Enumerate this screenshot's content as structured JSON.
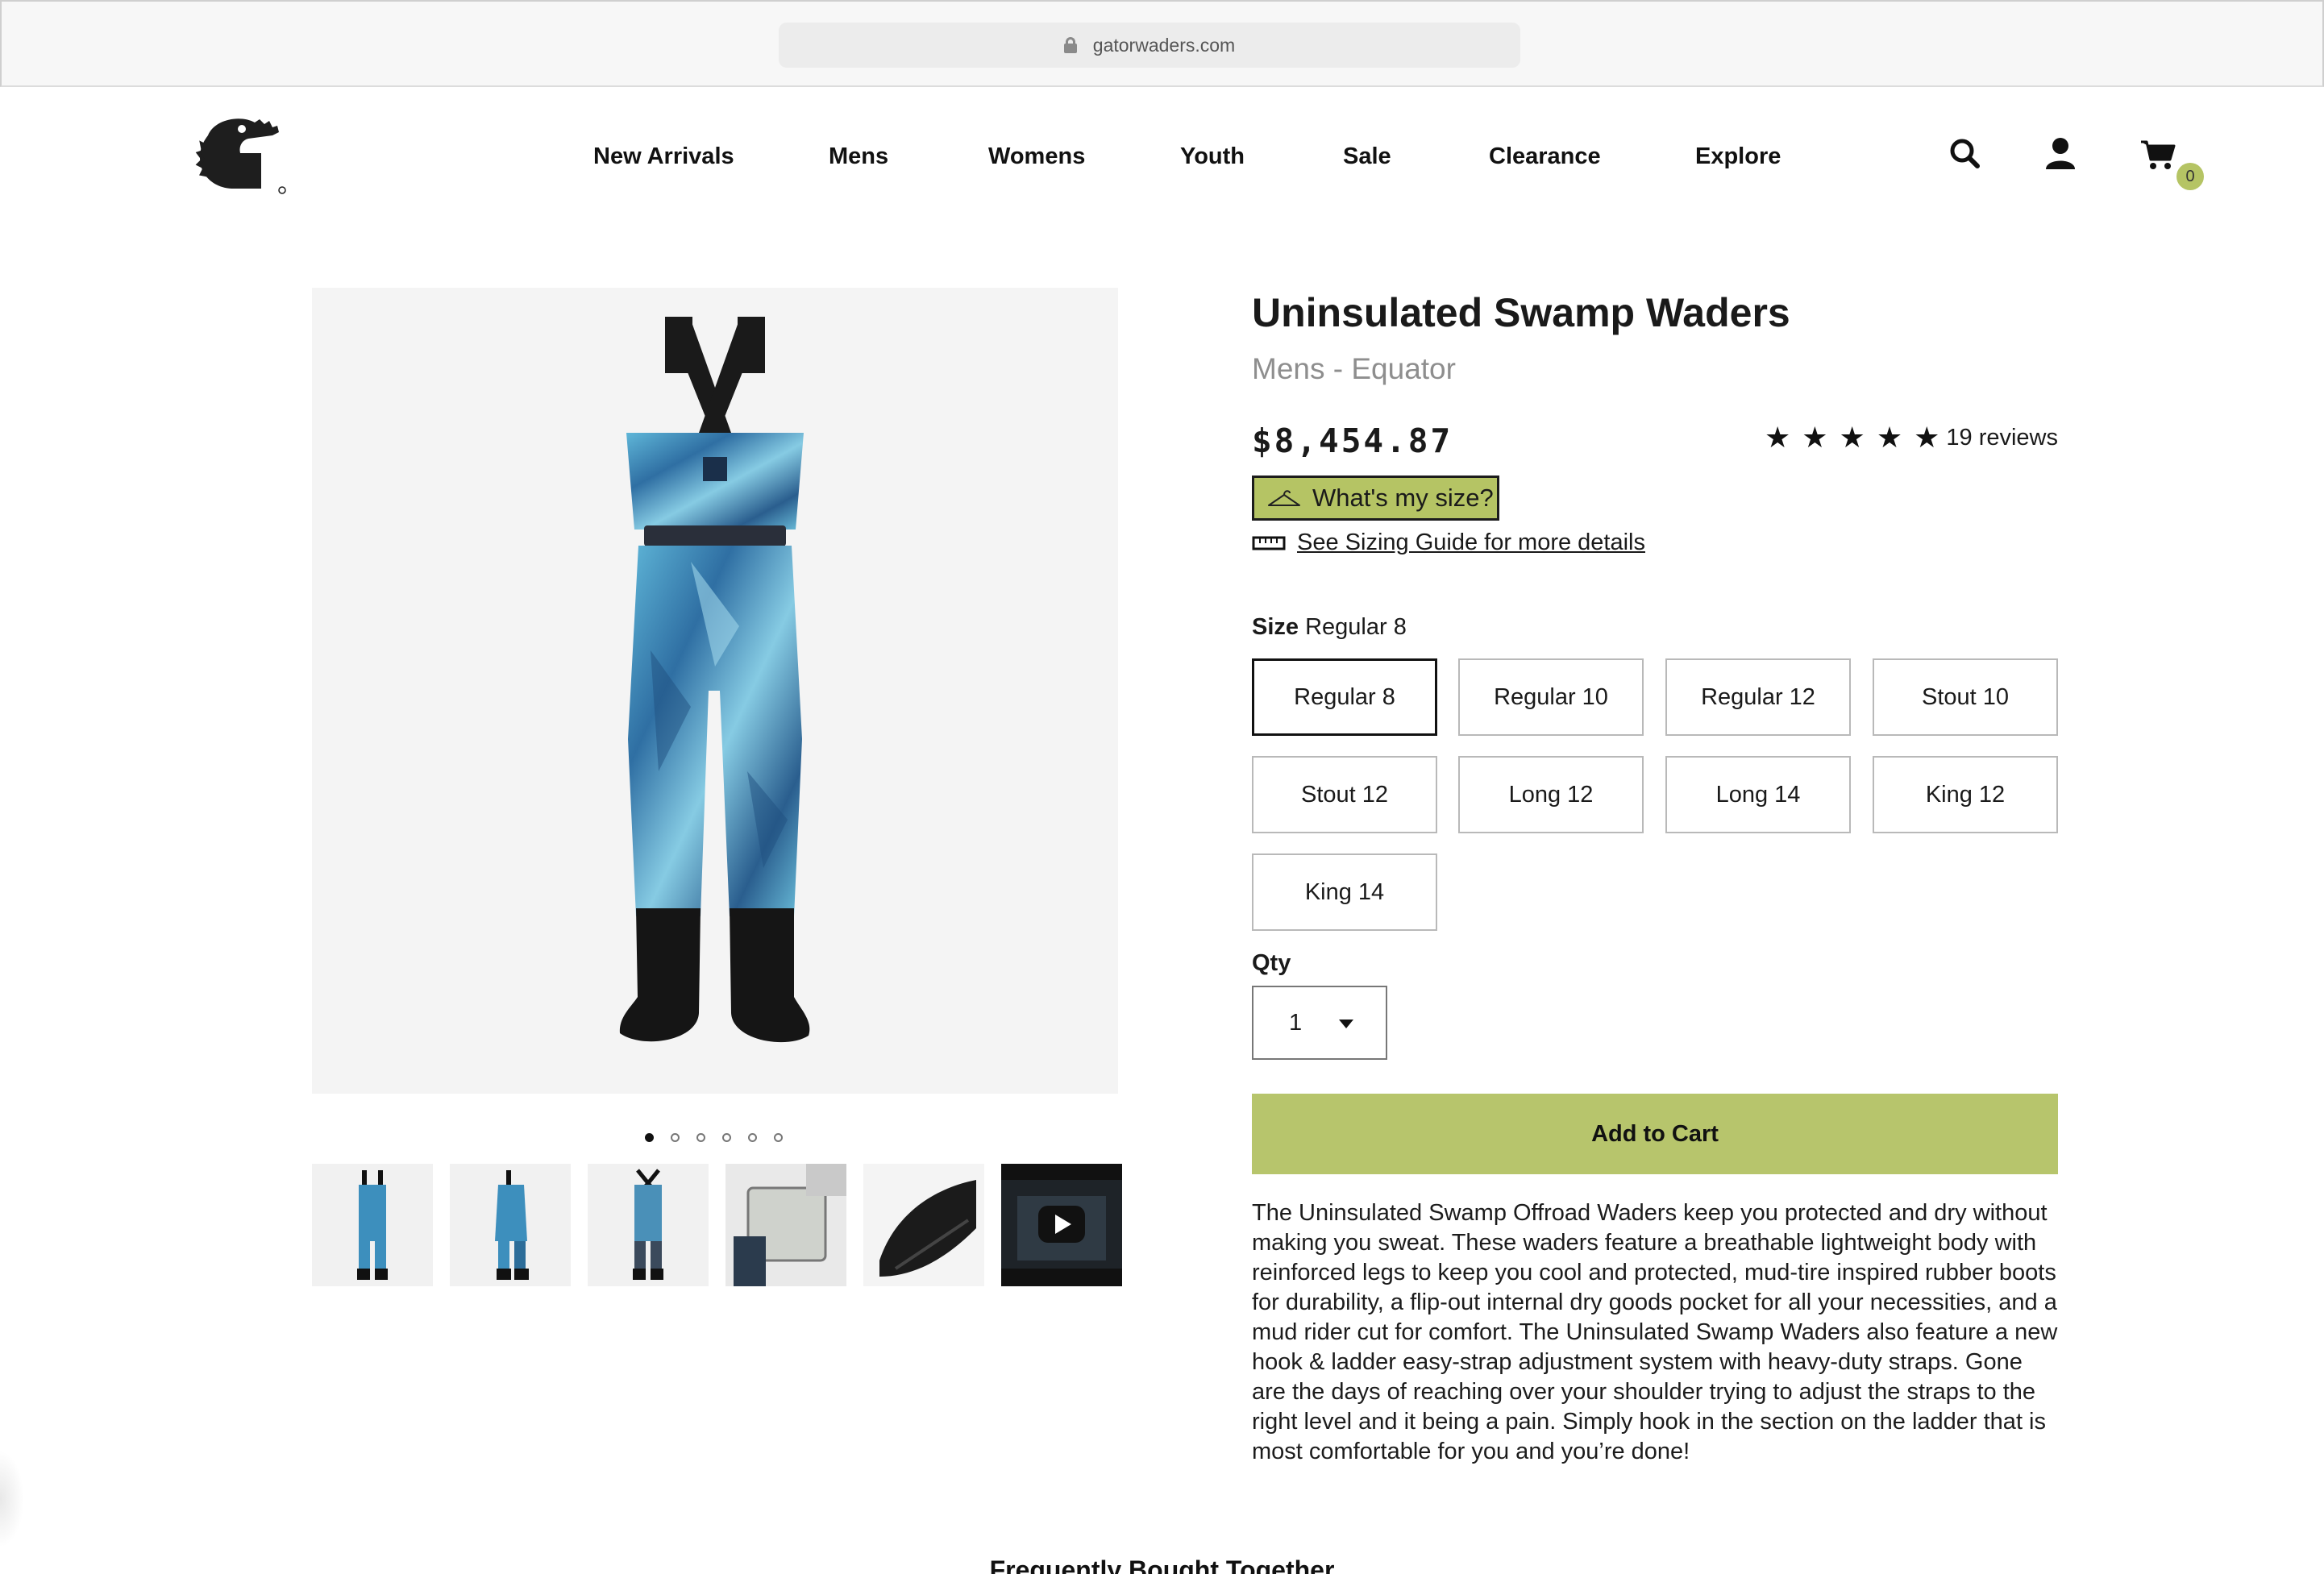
{
  "browser": {
    "url": "gatorwaders.com"
  },
  "header": {
    "logo_icon": "gator-head-logo",
    "nav": [
      {
        "label": "New Arrivals"
      },
      {
        "label": "Mens"
      },
      {
        "label": "Womens"
      },
      {
        "label": "Youth"
      },
      {
        "label": "Sale"
      },
      {
        "label": "Clearance"
      },
      {
        "label": "Explore"
      }
    ],
    "icons": [
      "search-icon",
      "account-icon",
      "cart-icon"
    ],
    "cart_count": "0"
  },
  "gallery": {
    "slides": 6,
    "active_slide": 1,
    "thumbnails": [
      {
        "name": "front-view"
      },
      {
        "name": "side-view"
      },
      {
        "name": "back-view"
      },
      {
        "name": "pocket-detail"
      },
      {
        "name": "boot-detail"
      },
      {
        "name": "video",
        "icon": "play-icon"
      }
    ]
  },
  "product": {
    "title": "Uninsulated Swamp Waders",
    "subtitle": "Mens - Equator",
    "price": "$8,454.87",
    "rating": 5,
    "reviews": "19 reviews",
    "size_help_label": "What's my size?",
    "sizing_link": "See Sizing Guide for more details",
    "size_heading": "Size",
    "size_selected": "Regular 8",
    "sizes": [
      {
        "label": "Regular 8",
        "selected": true
      },
      {
        "label": "Regular 10"
      },
      {
        "label": "Regular 12"
      },
      {
        "label": "Stout 10"
      },
      {
        "label": "Stout 12"
      },
      {
        "label": "Long 12"
      },
      {
        "label": "Long 14"
      },
      {
        "label": "King 12"
      },
      {
        "label": "King 14"
      }
    ],
    "qty_label": "Qty",
    "qty_value": "1",
    "add_to_cart": "Add to Cart",
    "description": "The Uninsulated Swamp Offroad Waders keep you protected and dry without making you sweat. These waders feature a breathable lightweight body with reinforced legs to keep you cool and protected, mud-tire inspired rubber boots for durability, a flip-out internal dry goods pocket for all your necessities, and a mud rider cut for comfort. The Uninsulated Swamp Waders also feature a new hook & ladder easy-strap adjustment system with heavy-duty straps. Gone are the days of reaching over your shoulder trying to adjust the straps to the right level and it being a pain. Simply hook in the section on the ladder that is most comfortable for you and you’re done!"
  },
  "sections": {
    "frequently_bought": "Frequently Bought Together"
  },
  "colors": {
    "accent": "#b7c56c",
    "badge": "#b5c464",
    "text": "#1a1a1a",
    "muted": "#8e8e8e"
  }
}
